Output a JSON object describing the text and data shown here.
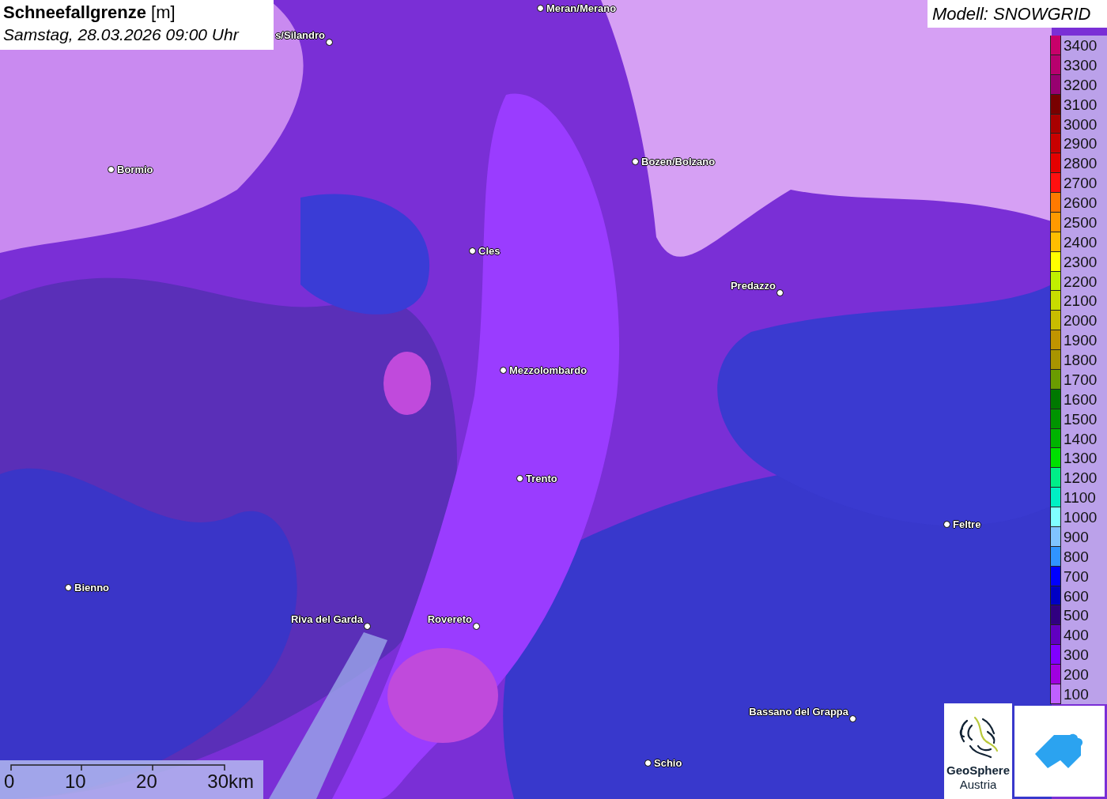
{
  "title": {
    "name": "Schneefallgrenze",
    "unit": "[m]",
    "datetime": "Samstag, 28.03.2026 09:00 Uhr"
  },
  "model": "Modell: SNOWGRID",
  "places": [
    "Meran/Merano",
    "s/Silandro",
    "Bormio",
    "Bozen/Bolzano",
    "Cles",
    "Predazzo",
    "Mezzolombardo",
    "Trento",
    "Feltre",
    "Bienno",
    "Riva del Garda",
    "Rovereto",
    "Bassano del Grappa",
    "Schio"
  ],
  "legend": [
    {
      "label": "3400",
      "color": "#c8006a"
    },
    {
      "label": "3300",
      "color": "#b8006e"
    },
    {
      "label": "3200",
      "color": "#980070"
    },
    {
      "label": "3100",
      "color": "#780000"
    },
    {
      "label": "3000",
      "color": "#a80000"
    },
    {
      "label": "2900",
      "color": "#c80000"
    },
    {
      "label": "2800",
      "color": "#e40000"
    },
    {
      "label": "2700",
      "color": "#ff1010"
    },
    {
      "label": "2600",
      "color": "#ff7a00"
    },
    {
      "label": "2500",
      "color": "#ff9a00"
    },
    {
      "label": "2400",
      "color": "#ffbe00"
    },
    {
      "label": "2300",
      "color": "#ffff00"
    },
    {
      "label": "2200",
      "color": "#c0f000"
    },
    {
      "label": "2100",
      "color": "#c8dc00"
    },
    {
      "label": "2000",
      "color": "#c8bc00"
    },
    {
      "label": "1900",
      "color": "#c09400"
    },
    {
      "label": "1800",
      "color": "#a89400"
    },
    {
      "label": "1700",
      "color": "#6a9c00"
    },
    {
      "label": "1600",
      "color": "#007800"
    },
    {
      "label": "1500",
      "color": "#009400"
    },
    {
      "label": "1400",
      "color": "#00b400"
    },
    {
      "label": "1300",
      "color": "#00e000"
    },
    {
      "label": "1200",
      "color": "#00ee88"
    },
    {
      "label": "1100",
      "color": "#00f0c4"
    },
    {
      "label": "1000",
      "color": "#80ffff"
    },
    {
      "label": "900",
      "color": "#80c4ff"
    },
    {
      "label": "800",
      "color": "#3094ff"
    },
    {
      "label": "700",
      "color": "#0000ff"
    },
    {
      "label": "600",
      "color": "#0000c4"
    },
    {
      "label": "500",
      "color": "#300080"
    },
    {
      "label": "400",
      "color": "#6000c0"
    },
    {
      "label": "300",
      "color": "#8000ff"
    },
    {
      "label": "200",
      "color": "#a000e0"
    },
    {
      "label": "100",
      "color": "#c060ff"
    }
  ],
  "scale_bar": {
    "ticks": [
      "0",
      "10",
      "20",
      "30km"
    ]
  },
  "logo": {
    "name": "GeoSphere",
    "country": "Austria"
  }
}
